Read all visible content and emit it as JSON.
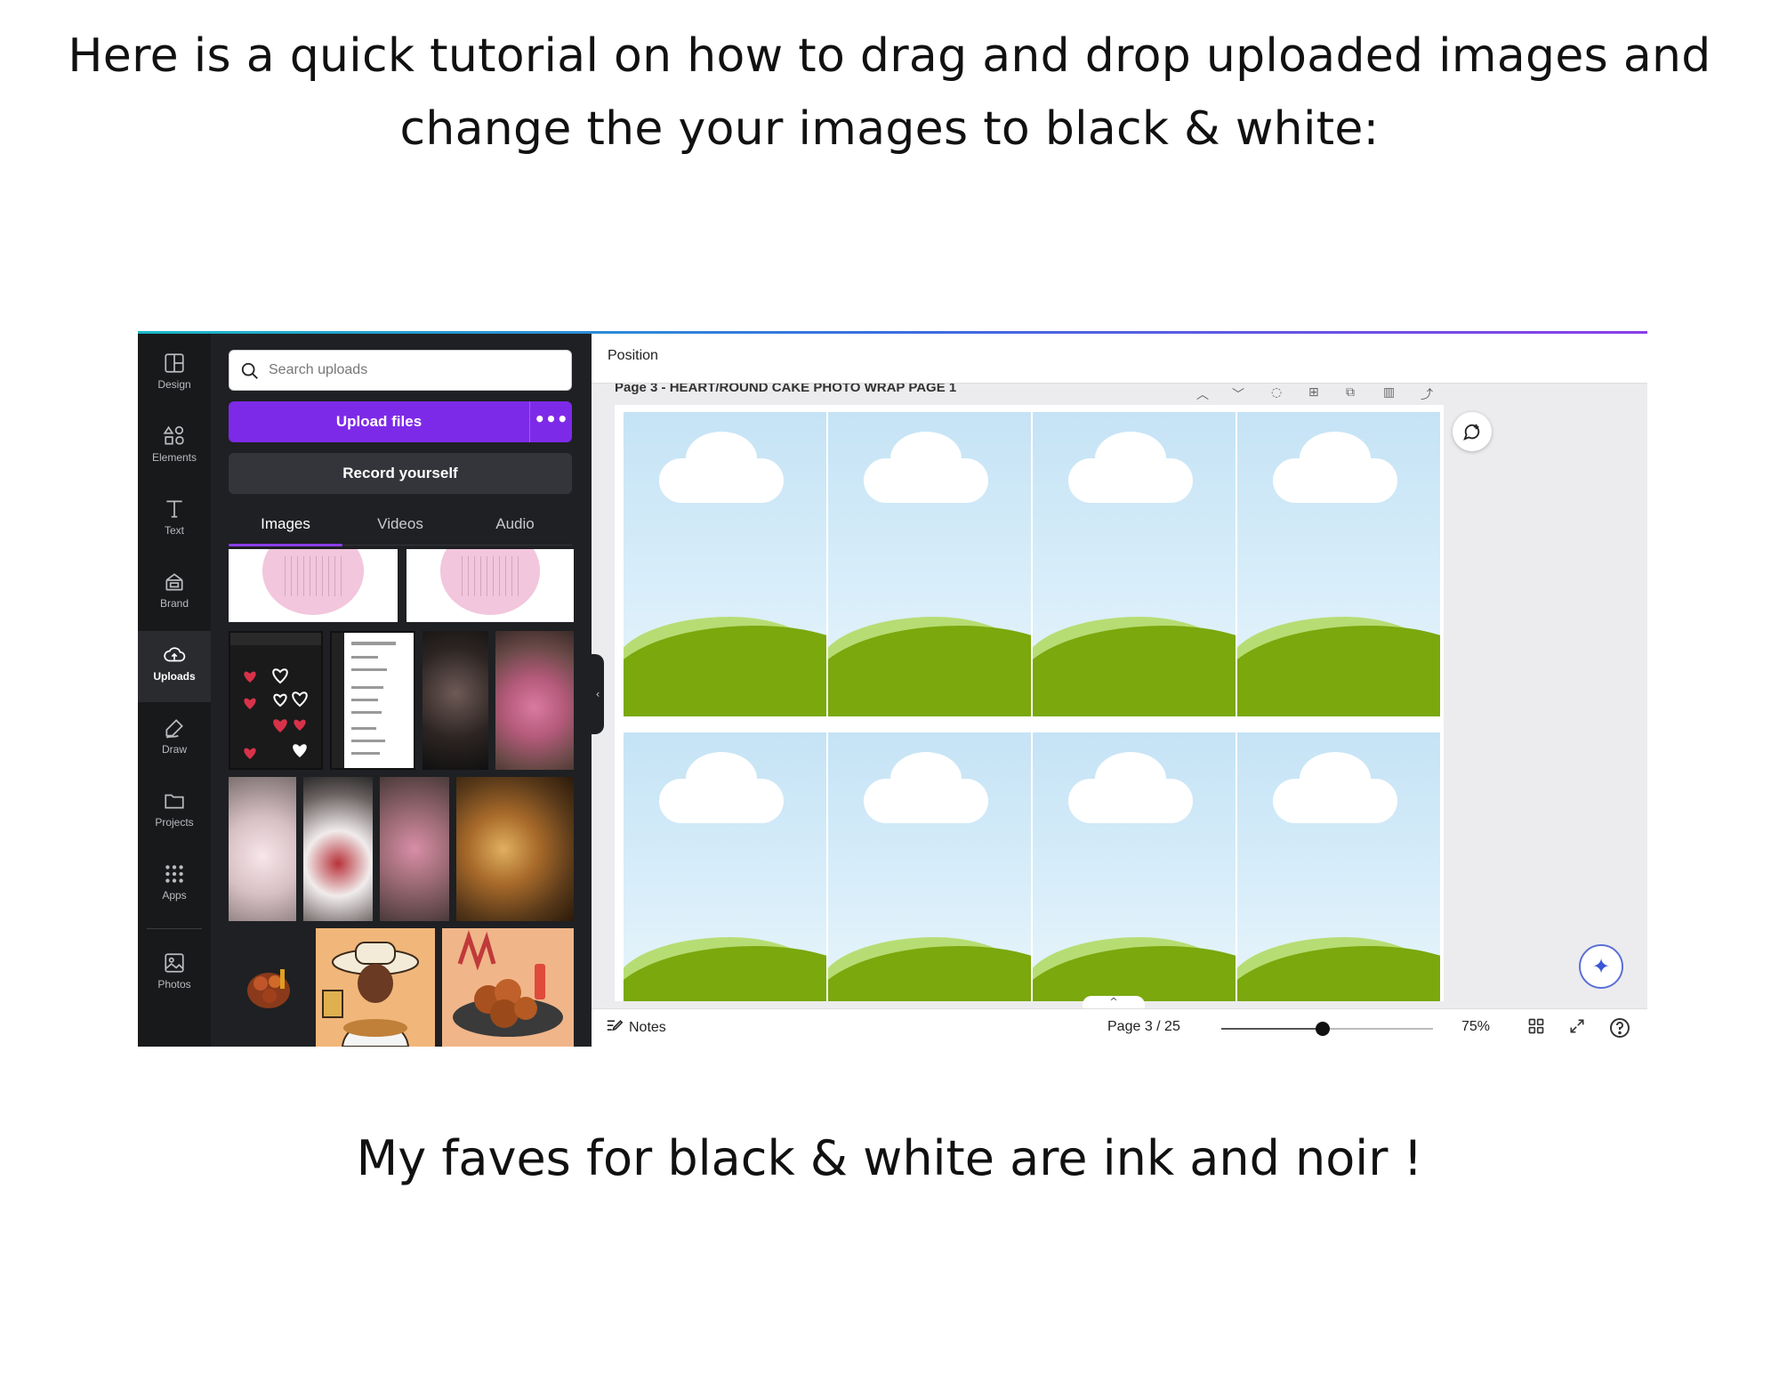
{
  "heading_line1": "Here is a quick tutorial on how to drag and drop uploaded images and",
  "heading_line2": "change the your images to black & white:",
  "footer_note": "My faves for black & white are ink and noir !",
  "rail": {
    "items": [
      {
        "label": "Design",
        "icon": "design-icon"
      },
      {
        "label": "Elements",
        "icon": "elements-icon"
      },
      {
        "label": "Text",
        "icon": "text-icon"
      },
      {
        "label": "Brand",
        "icon": "brand-icon"
      },
      {
        "label": "Uploads",
        "icon": "uploads-icon"
      },
      {
        "label": "Draw",
        "icon": "draw-icon"
      },
      {
        "label": "Projects",
        "icon": "projects-icon"
      },
      {
        "label": "Apps",
        "icon": "apps-icon"
      },
      {
        "label": "Photos",
        "icon": "photos-icon"
      }
    ],
    "active": "Uploads"
  },
  "panel": {
    "search_placeholder": "Search uploads",
    "upload_label": "Upload files",
    "upload_more": "•••",
    "record_label": "Record yourself",
    "tabs": [
      "Images",
      "Videos",
      "Audio"
    ],
    "active_tab": "Images"
  },
  "canvas": {
    "toolbar_label": "Position",
    "page_title": "Page 3 - HEART/ROUND CAKE PHOTO WRAP PAGE 1"
  },
  "bottombar": {
    "notes_label": "Notes",
    "page_indicator": "Page 3 / 25",
    "zoom_label": "75%",
    "zoom_level": 0.75
  },
  "colors": {
    "accent": "#7d2ae8",
    "rail_bg": "#18191b",
    "panel_bg": "#1f2023",
    "sky": "#c5e3f5",
    "hill_light": "#b6dd74",
    "hill_dark": "#7aa80d"
  }
}
